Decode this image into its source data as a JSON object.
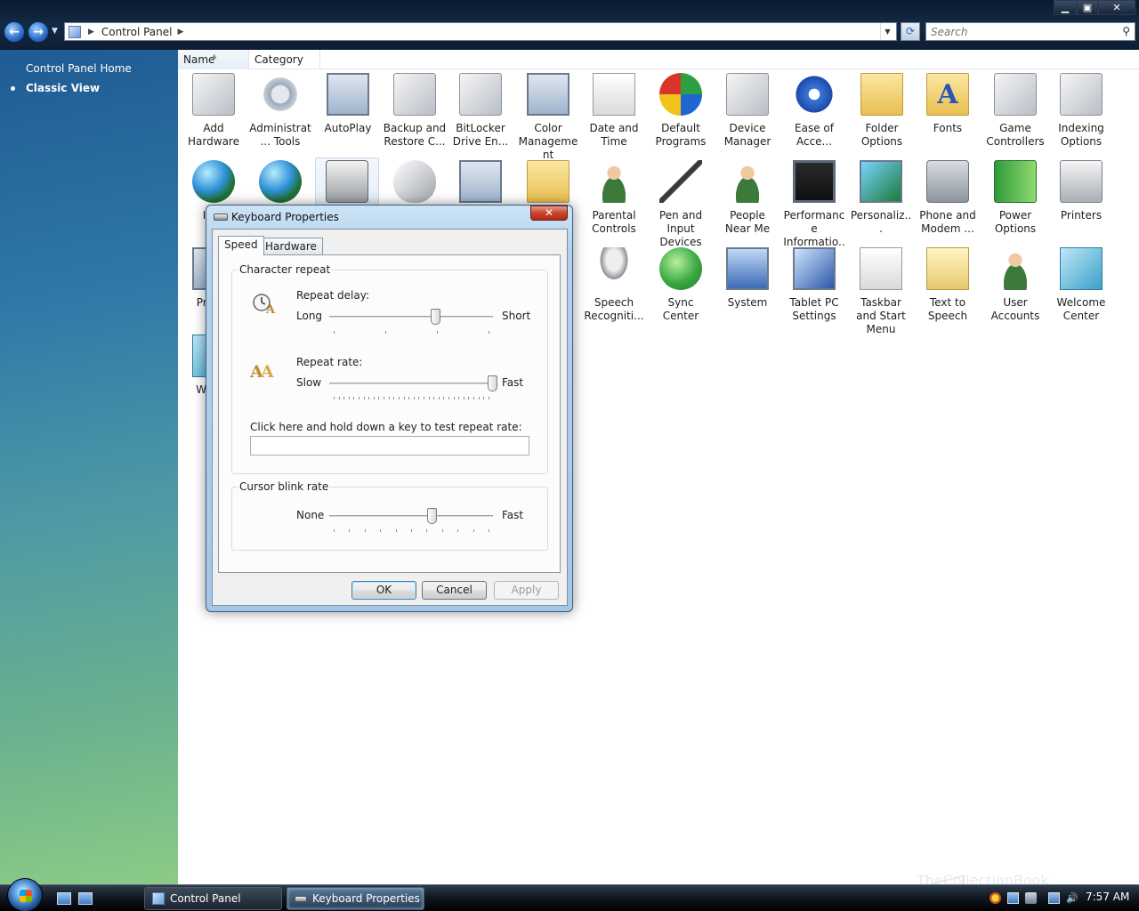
{
  "explorer": {
    "address": {
      "root_label": "Control Panel"
    },
    "search": {
      "placeholder": "Search"
    },
    "window_buttons": {
      "minimize": "▁",
      "maximize": "▣",
      "close": "✕"
    }
  },
  "left_pane": {
    "home_link": "Control Panel Home",
    "classic_view": "Classic View"
  },
  "columns": [
    "Name",
    "Category"
  ],
  "items": [
    {
      "label": "Add Hardware",
      "icon": "add-hardware-icon"
    },
    {
      "label": "Administrat... Tools",
      "icon": "administrative-tools-icon"
    },
    {
      "label": "AutoPlay",
      "icon": "autoplay-icon"
    },
    {
      "label": "Backup and Restore C...",
      "icon": "backup-restore-icon"
    },
    {
      "label": "BitLocker Drive En...",
      "icon": "bitlocker-icon"
    },
    {
      "label": "Color Management",
      "icon": "color-management-icon"
    },
    {
      "label": "Date and Time",
      "icon": "date-time-icon"
    },
    {
      "label": "Default Programs",
      "icon": "default-programs-icon"
    },
    {
      "label": "Device Manager",
      "icon": "device-manager-icon"
    },
    {
      "label": "Ease of Acce...",
      "icon": "ease-of-access-icon"
    },
    {
      "label": "Folder Options",
      "icon": "folder-options-icon"
    },
    {
      "label": "Fonts",
      "icon": "fonts-icon"
    },
    {
      "label": "Game Controllers",
      "icon": "game-controllers-icon"
    },
    {
      "label": "Indexing Options",
      "icon": "indexing-options-icon"
    },
    {
      "label": "In O",
      "icon": "internet-options-icon"
    },
    {
      "label": "",
      "icon": "network-globe-icon"
    },
    {
      "label": "",
      "icon": "keyboard-icon"
    },
    {
      "label": "",
      "icon": "mouse-icon"
    },
    {
      "label": "",
      "icon": "network-sharing-icon"
    },
    {
      "label": "",
      "icon": "offline-files-icon"
    },
    {
      "label": "Parental Controls",
      "icon": "parental-controls-icon"
    },
    {
      "label": "Pen and Input Devices",
      "icon": "pen-input-icon"
    },
    {
      "label": "People Near Me",
      "icon": "people-near-me-icon"
    },
    {
      "label": "Performance Informatio...",
      "icon": "performance-icon"
    },
    {
      "label": "Personaliz...",
      "icon": "personalization-icon"
    },
    {
      "label": "Phone and Modem ...",
      "icon": "phone-modem-icon"
    },
    {
      "label": "Power Options",
      "icon": "power-options-icon"
    },
    {
      "label": "Printers",
      "icon": "printers-icon"
    },
    {
      "label": "Pr Rep",
      "icon": "problem-reports-icon"
    },
    {
      "label": "Speech Recogniti...",
      "icon": "speech-recognition-icon"
    },
    {
      "label": "Sync Center",
      "icon": "sync-center-icon"
    },
    {
      "label": "System",
      "icon": "system-icon"
    },
    {
      "label": "Tablet PC Settings",
      "icon": "tablet-pc-icon"
    },
    {
      "label": "Taskbar and Start Menu",
      "icon": "taskbar-start-icon"
    },
    {
      "label": "Text to Speech",
      "icon": "text-to-speech-icon"
    },
    {
      "label": "User Accounts",
      "icon": "user-accounts-icon"
    },
    {
      "label": "Welcome Center",
      "icon": "welcome-center-icon"
    },
    {
      "label": "Wi Car",
      "icon": "windows-cardspace-icon"
    }
  ],
  "dialog": {
    "title": "Keyboard Properties",
    "close": "✕",
    "tabs": [
      "Speed",
      "Hardware"
    ],
    "active_tab": "Speed",
    "char_repeat": {
      "title": "Character repeat",
      "delay": {
        "label": "Repeat delay:",
        "min": "Long",
        "max": "Short",
        "value": 0.65
      },
      "rate": {
        "label": "Repeat rate:",
        "min": "Slow",
        "max": "Fast",
        "value": 1.0
      },
      "test_label": "Click here and hold down a key to test repeat rate:",
      "test_value": ""
    },
    "blink": {
      "title": "Cursor blink rate",
      "min": "None",
      "max": "Fast",
      "value": 0.63
    },
    "buttons": {
      "ok": "OK",
      "cancel": "Cancel",
      "apply": "Apply"
    }
  },
  "taskbar": {
    "buttons": [
      "Control Panel",
      "Keyboard Properties"
    ],
    "clock": "7:57 AM"
  },
  "watermark": "TheCollectionBook"
}
